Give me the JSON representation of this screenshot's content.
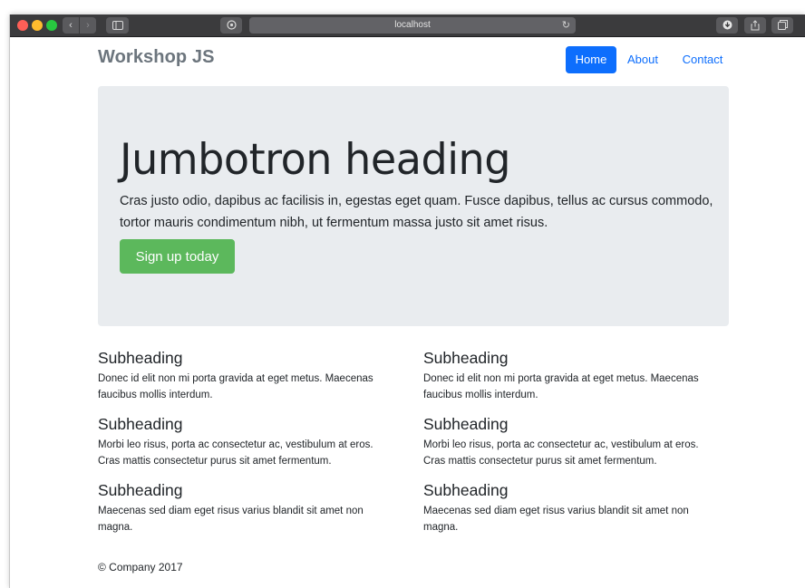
{
  "browser": {
    "address": "localhost",
    "reload_glyph": "↻",
    "nav_back_glyph": "‹",
    "nav_forward_glyph": "›",
    "icons": [
      "sidebar-icon",
      "privacy-icon",
      "reload-icon",
      "download-icon",
      "share-icon",
      "tabs-icon"
    ]
  },
  "header": {
    "brand": "Workshop JS",
    "nav": [
      {
        "label": "Home",
        "active": true
      },
      {
        "label": "About",
        "active": false
      },
      {
        "label": "Contact",
        "active": false
      }
    ]
  },
  "jumbotron": {
    "heading": "Jumbotron heading",
    "lead": "Cras justo odio, dapibus ac facilisis in, egestas eget quam. Fusce dapibus, tellus ac cursus commodo, tortor mauris condimentum nibh, ut fermentum massa justo sit amet risus.",
    "button": "Sign up today"
  },
  "features": {
    "left": [
      {
        "heading": "Subheading",
        "text": "Donec id elit non mi porta gravida at eget metus. Maecenas faucibus mollis interdum."
      },
      {
        "heading": "Subheading",
        "text": "Morbi leo risus, porta ac consectetur ac, vestibulum at eros. Cras mattis consectetur purus sit amet fermentum."
      },
      {
        "heading": "Subheading",
        "text": "Maecenas sed diam eget risus varius blandit sit amet non magna."
      }
    ],
    "right": [
      {
        "heading": "Subheading",
        "text": "Donec id elit non mi porta gravida at eget metus. Maecenas faucibus mollis interdum."
      },
      {
        "heading": "Subheading",
        "text": "Morbi leo risus, porta ac consectetur ac, vestibulum at eros. Cras mattis consectetur purus sit amet fermentum."
      },
      {
        "heading": "Subheading",
        "text": "Maecenas sed diam eget risus varius blandit sit amet non magna."
      }
    ]
  },
  "footer": {
    "text": "© Company 2017"
  },
  "colors": {
    "primary": "#0d6efd",
    "success": "#5cb85c",
    "jumbotron_bg": "#e9ecef",
    "brand_text": "#6c757d"
  }
}
